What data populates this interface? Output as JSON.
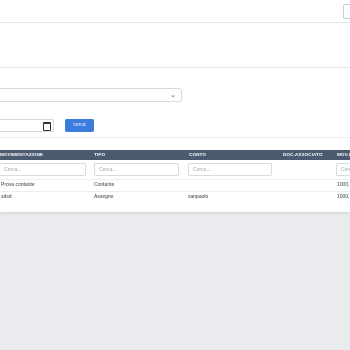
{
  "filters_panel": {
    "search_button_label": "cerca"
  },
  "table": {
    "columns": [
      {
        "key": "movimentazione",
        "label": "MOVIMENTAZIONE"
      },
      {
        "key": "tipo",
        "label": "TIPO"
      },
      {
        "key": "conto",
        "label": "CONTO"
      },
      {
        "key": "doc_associato",
        "label": "DOC.ASSOCIATO"
      },
      {
        "key": "mov",
        "label": "MOV.I"
      }
    ],
    "filter_placeholder": "Cerca...",
    "rows": [
      {
        "movimentazione": "Prova contante",
        "tipo": "Contante",
        "conto": "",
        "doc_associato": "",
        "mov": "1000,"
      },
      {
        "movimentazione": "sdsd",
        "tipo": "Assegno",
        "conto": "sanpaolo",
        "doc_associato": "",
        "mov": "1000,"
      }
    ]
  }
}
